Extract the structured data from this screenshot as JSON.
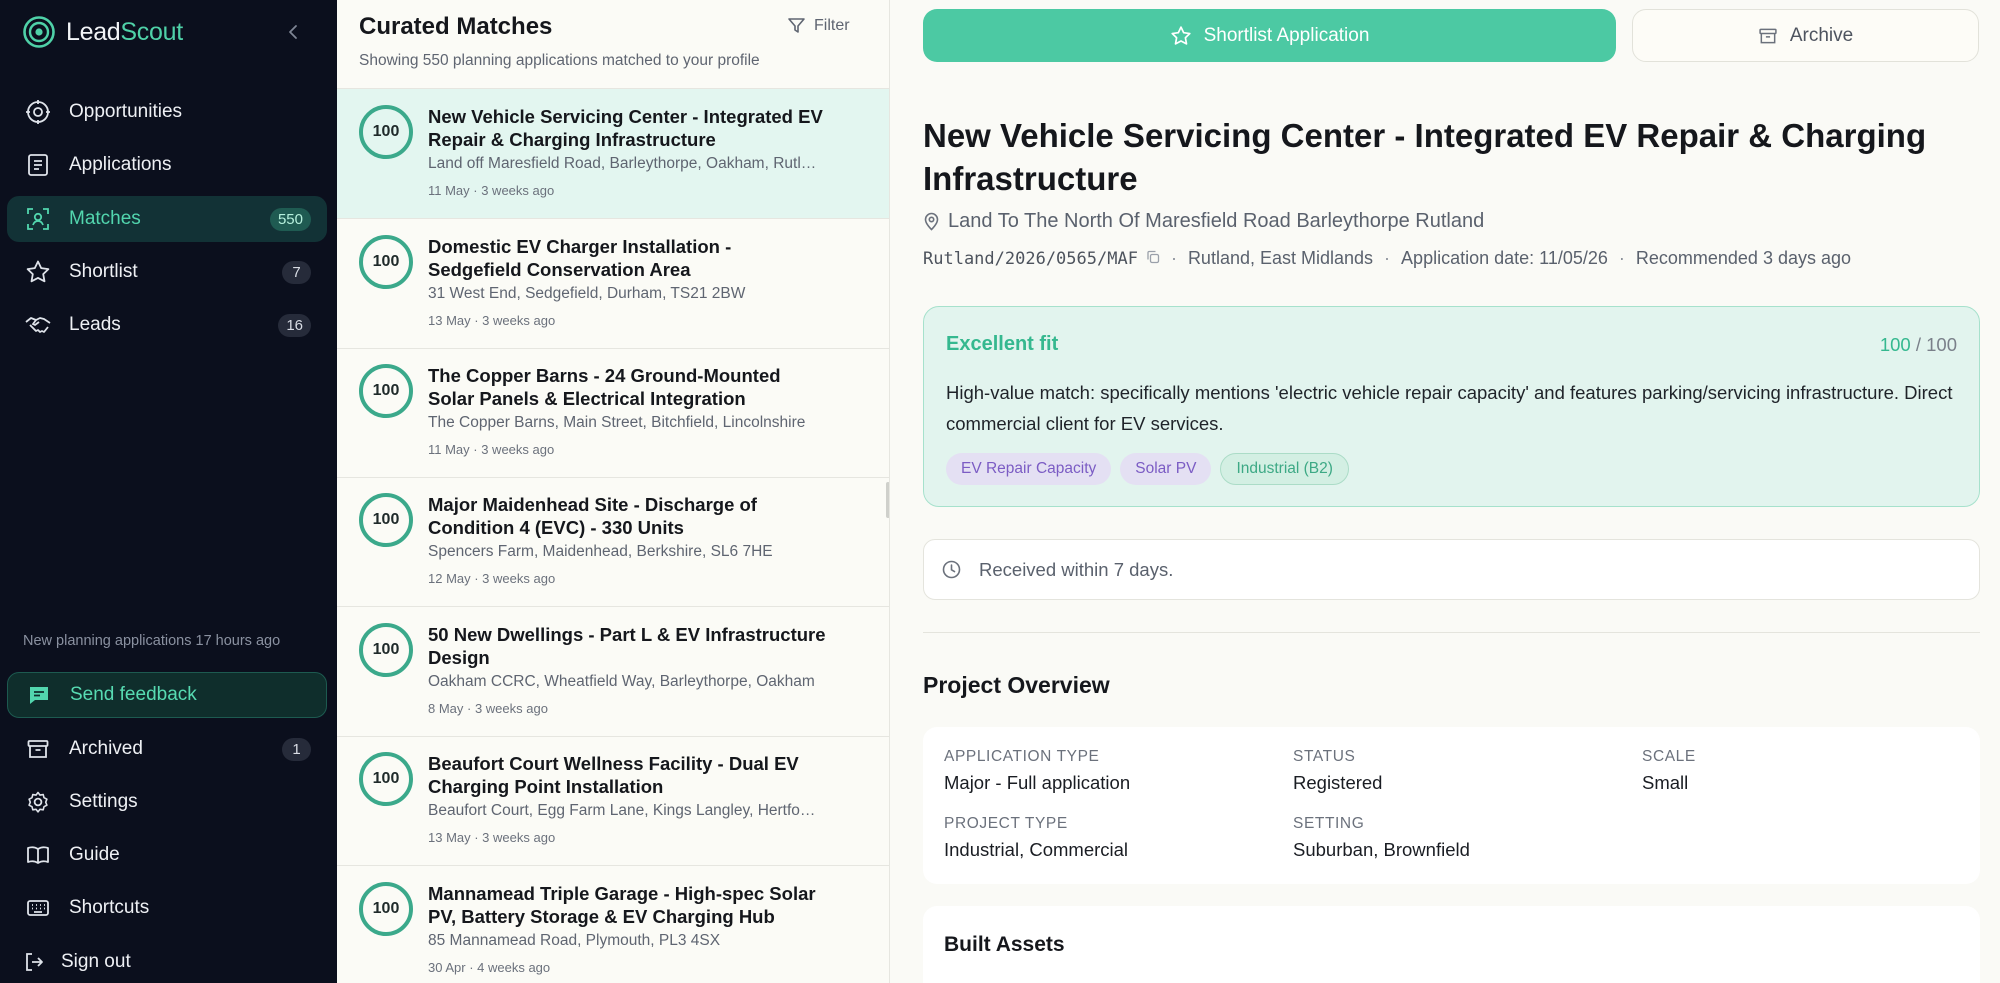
{
  "brand": {
    "name_a": "Lead",
    "name_b": "Scout",
    "accent": "#4fd1a8"
  },
  "sidebar": {
    "nav": [
      {
        "label": "Opportunities",
        "icon": "target-icon"
      },
      {
        "label": "Applications",
        "icon": "document-icon"
      },
      {
        "label": "Matches",
        "icon": "scan-user-icon",
        "count": "550",
        "active": true
      },
      {
        "label": "Shortlist",
        "icon": "star-icon",
        "count": "7"
      },
      {
        "label": "Leads",
        "icon": "handshake-icon",
        "count": "16"
      }
    ],
    "sync_note": "New planning applications 17 hours ago",
    "bottom": [
      {
        "label": "Send feedback",
        "icon": "message-icon"
      },
      {
        "label": "Archived",
        "icon": "archive-icon",
        "count": "1"
      },
      {
        "label": "Settings",
        "icon": "gear-icon"
      },
      {
        "label": "Guide",
        "icon": "book-icon"
      },
      {
        "label": "Shortcuts",
        "icon": "keyboard-icon"
      },
      {
        "label": "Sign out",
        "icon": "sign-out-icon"
      }
    ]
  },
  "list": {
    "title": "Curated Matches",
    "subtitle": "Showing 550 planning applications matched to your profile",
    "filter_label": "Filter",
    "items": [
      {
        "score": "100",
        "title": "New Vehicle Servicing Center - Integrated EV Repair & Charging Infrastructure",
        "address": "Land off Maresfield Road, Barleythorpe, Oakham, Rutland",
        "meta": "11 May · 3 weeks ago"
      },
      {
        "score": "100",
        "title": "Domestic EV Charger Installation - Sedgefield Conservation Area",
        "address": "31 West End, Sedgefield, Durham, TS21 2BW",
        "meta": "13 May · 3 weeks ago"
      },
      {
        "score": "100",
        "title": "The Copper Barns - 24 Ground-Mounted Solar Panels & Electrical Integration",
        "address": "The Copper Barns, Main Street, Bitchfield, Lincolnshire",
        "meta": "11 May · 3 weeks ago"
      },
      {
        "score": "100",
        "title": "Major Maidenhead Site - Discharge of Condition 4 (EVC) - 330 Units",
        "address": "Spencers Farm, Maidenhead, Berkshire, SL6 7HE",
        "meta": "12 May · 3 weeks ago"
      },
      {
        "score": "100",
        "title": "50 New Dwellings - Part L & EV Infrastructure Design",
        "address": "Oakham CCRC, Wheatfield Way, Barleythorpe, Oakham",
        "meta": "8 May · 3 weeks ago"
      },
      {
        "score": "100",
        "title": "Beaufort Court Wellness Facility - Dual EV Charging Point Installation",
        "address": "Beaufort Court, Egg Farm Lane, Kings Langley, Hertfordshire",
        "meta": "13 May · 3 weeks ago"
      },
      {
        "score": "100",
        "title": "Mannamead Triple Garage - High-spec Solar PV, Battery Storage & EV Charging Hub",
        "address": "85 Mannamead Road, Plymouth, PL3 4SX",
        "meta": "30 Apr · 4 weeks ago"
      }
    ]
  },
  "detail": {
    "shortlist_label": "Shortlist Application",
    "archive_label": "Archive",
    "title": "New Vehicle Servicing Center - Integrated EV Repair & Charging Infrastructure",
    "location": "Land To The North Of Maresfield Road Barleythorpe Rutland",
    "reference": "Rutland/2026/0565/MAF",
    "region": "Rutland, East Midlands",
    "application_date": "Application date: 11/05/26",
    "recommended": "Recommended 3 days ago",
    "fit": {
      "label": "Excellent fit",
      "score": "100",
      "max": "/ 100",
      "reason": "High-value match: specifically mentions 'electric vehicle repair capacity' and features parking/servicing infrastructure. Direct commercial client for EV services.",
      "tags": [
        {
          "label": "EV Repair Capacity",
          "style": "purple"
        },
        {
          "label": "Solar PV",
          "style": "purple"
        },
        {
          "label": "Industrial (B2)",
          "style": "green"
        }
      ]
    },
    "received": "Received within 7 days.",
    "overview": {
      "title": "Project Overview",
      "fields": [
        {
          "key": "APPLICATION TYPE",
          "value": "Major - Full application"
        },
        {
          "key": "STATUS",
          "value": "Registered"
        },
        {
          "key": "SCALE",
          "value": "Small"
        },
        {
          "key": "PROJECT TYPE",
          "value": "Industrial, Commercial"
        },
        {
          "key": "SETTING",
          "value": "Suburban, Brownfield"
        }
      ]
    },
    "assets_title": "Built Assets"
  }
}
